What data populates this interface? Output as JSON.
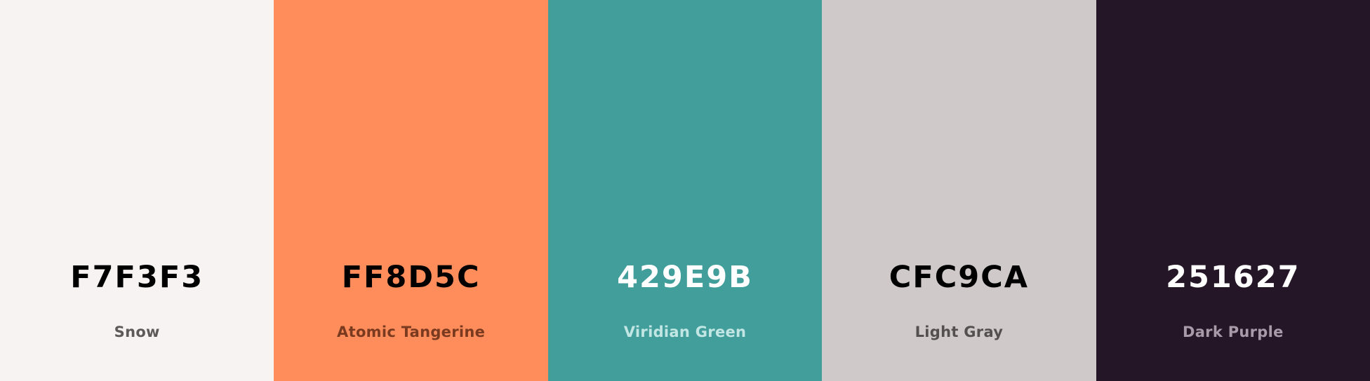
{
  "palette": {
    "swatches": [
      {
        "hex": "F7F3F3",
        "name": "Snow",
        "color": "#F7F3F3",
        "hex_text_color": "#000000",
        "name_text_color": "#5f5a5a"
      },
      {
        "hex": "FF8D5C",
        "name": "Atomic Tangerine",
        "color": "#FF8D5C",
        "hex_text_color": "#000000",
        "name_text_color": "#7a3a1f"
      },
      {
        "hex": "429E9B",
        "name": "Viridian Green",
        "color": "#429E9B",
        "hex_text_color": "#ffffff",
        "name_text_color": "#c2e6e4"
      },
      {
        "hex": "CFC9CA",
        "name": "Light Gray",
        "color": "#CFC9CA",
        "hex_text_color": "#000000",
        "name_text_color": "#555050"
      },
      {
        "hex": "251627",
        "name": "Dark Purple",
        "color": "#251627",
        "hex_text_color": "#ffffff",
        "name_text_color": "#a89aa8"
      }
    ]
  }
}
